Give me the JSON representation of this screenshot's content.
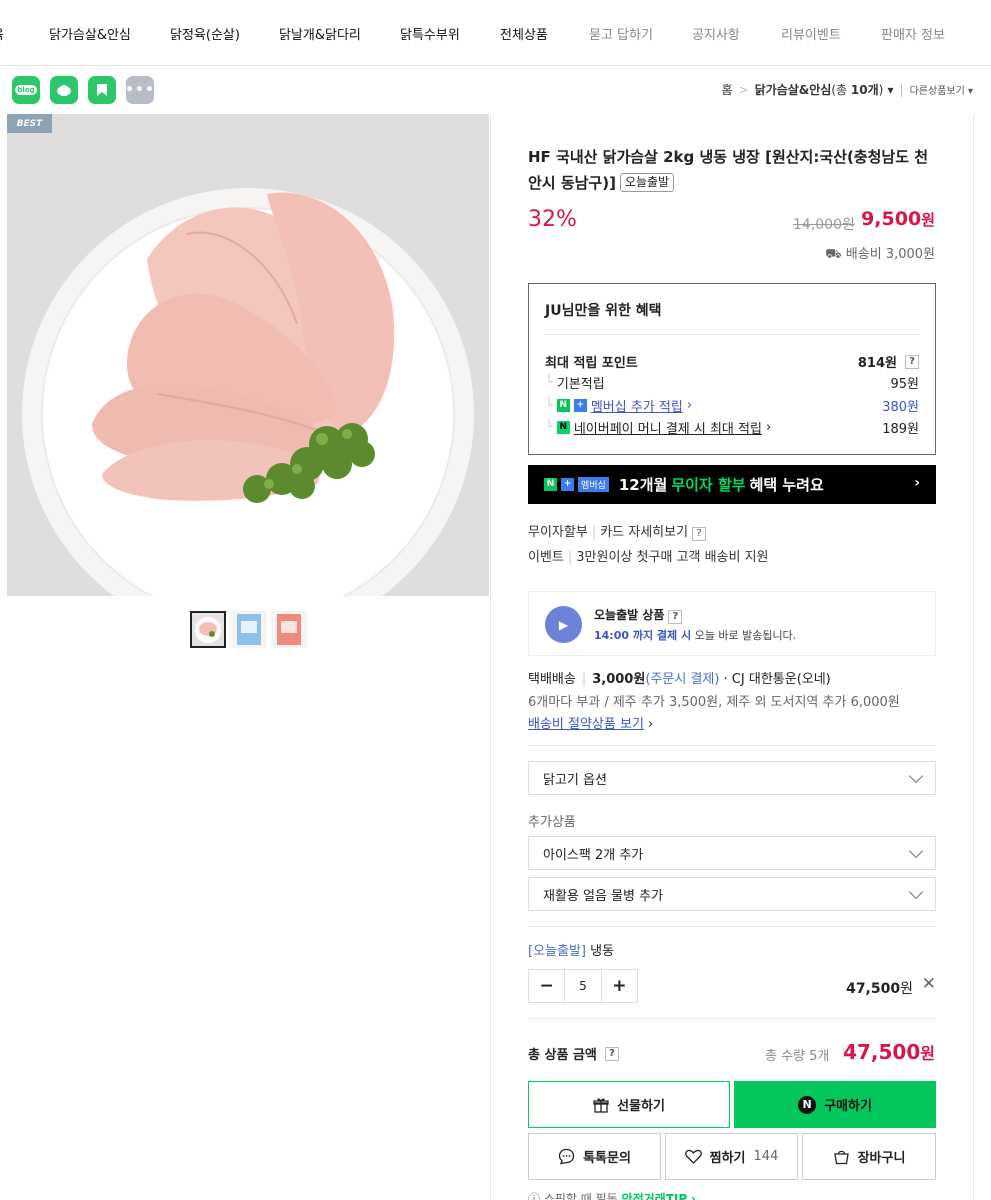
{
  "nav": {
    "items": [
      {
        "label": "육",
        "dim": false
      },
      {
        "label": "닭가슴살&안심",
        "dim": false
      },
      {
        "label": "닭정육(순살)",
        "dim": false
      },
      {
        "label": "닭날개&닭다리",
        "dim": false
      },
      {
        "label": "닭특수부위",
        "dim": false
      },
      {
        "label": "전체상품",
        "dim": false
      },
      {
        "label": "묻고 답하기",
        "dim": true
      },
      {
        "label": "공지사항",
        "dim": true
      },
      {
        "label": "리뷰이벤트",
        "dim": true
      },
      {
        "label": "판매자 정보",
        "dim": true
      }
    ]
  },
  "social": {
    "blog_label": "blog",
    "colors": {
      "blog": "#2cc66b",
      "cafe": "#2cc66b",
      "bookmark": "#2cc66b",
      "more": "#b7bcc6"
    }
  },
  "breadcrumb": {
    "home": "홈",
    "current": "닭가슴살&안심",
    "count_prefix": "(총 ",
    "count": "10개",
    "count_suffix": ")",
    "other": "다른상품보기"
  },
  "image": {
    "badge": "BEST"
  },
  "product": {
    "title": "HF 국내산 닭가슴살 2kg 냉동 냉장 [원산지:국산(충청남도 천안시 동남구)]",
    "tag": "오늘출발",
    "discount": "32%",
    "original_price": "14,000원",
    "sale_price": "9,500",
    "sale_unit": "원",
    "shipping_mini": "배송비 3,000원"
  },
  "benefit": {
    "title": "JU님만을 위한 혜택",
    "max_label": "최대 적립 포인트",
    "max_value": "814원",
    "rows": [
      {
        "label": "기본적립",
        "value": "95원"
      },
      {
        "label": "멤버십 추가 적립",
        "value": "380원"
      },
      {
        "label": "네이버페이 머니 결제 시 최대 적립",
        "value": "189원"
      }
    ]
  },
  "banner": {
    "membership": "멤버십",
    "text_a": "12개월",
    "text_hl": "무이자 할부",
    "text_b": "혜택 누려요"
  },
  "installment": {
    "label": "무이자할부",
    "link": "카드 자세히보기"
  },
  "event": {
    "label": "이벤트",
    "text": "3만원이상 첫구매 고객 배송비 지원"
  },
  "today_ship": {
    "title": "오늘출발 상품",
    "time": "14:00 까지 결제 시",
    "desc": "오늘 바로 발송됩니다."
  },
  "delivery": {
    "method": "택배배송",
    "price": "3,000원",
    "pay": "(주문시 결제)",
    "carrier": "· CJ 대한통운(오네)",
    "extra": "6개마다 부과 / 제주 추가 3,500원, 제주 외 도서지역 추가 6,000원",
    "saving_link": "배송비 절약상품 보기"
  },
  "options": {
    "main_select": "닭고기 옵션",
    "addon_label": "추가상품",
    "addons": [
      "아이스팩 2개 추가",
      "재활용 얼음 물병 추가"
    ]
  },
  "selected": {
    "tag": "[오늘출발]",
    "name": "냉동",
    "qty": "5",
    "price": "47,500",
    "unit": "원"
  },
  "total": {
    "label": "총 상품 금액",
    "qty": "총 수량 5개",
    "price": "47,500",
    "unit": "원"
  },
  "buttons": {
    "gift": "선물하기",
    "buy": "구매하기",
    "talk": "톡톡문의",
    "wish": "찜하기",
    "wish_count": "144",
    "cart": "장바구니"
  },
  "footer": {
    "text": "쇼핑할 때 필독",
    "link": "안전거래TIP"
  },
  "colors": {
    "accent": "#d6174a",
    "naver_green": "#03c75a",
    "link_blue": "#3b55c8"
  }
}
